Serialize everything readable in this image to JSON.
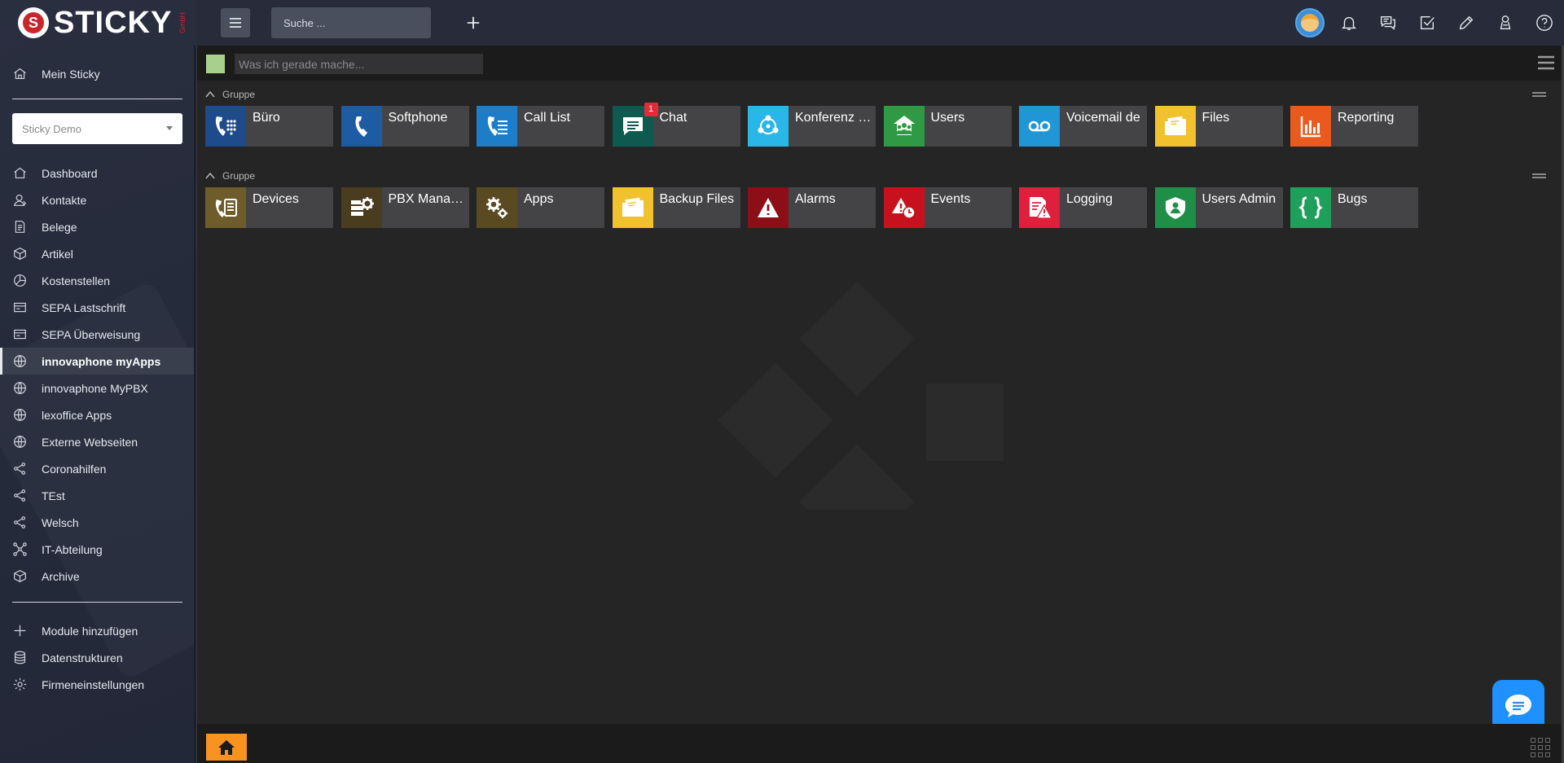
{
  "brand": {
    "name": "STICKY",
    "sub": "GmbH",
    "mark": "S"
  },
  "sidebar": {
    "top_item": {
      "label": "Mein Sticky",
      "icon": "home-chart-icon"
    },
    "tenant": {
      "selected": "Sticky Demo"
    },
    "items": [
      {
        "label": "Dashboard",
        "icon": "home-icon"
      },
      {
        "label": "Kontakte",
        "icon": "contacts-icon"
      },
      {
        "label": "Belege",
        "icon": "document-icon"
      },
      {
        "label": "Artikel",
        "icon": "box-icon"
      },
      {
        "label": "Kostenstellen",
        "icon": "pie-icon"
      },
      {
        "label": "SEPA Lastschrift",
        "icon": "card-icon"
      },
      {
        "label": "SEPA Überweisung",
        "icon": "card-icon"
      },
      {
        "label": "innovaphone myApps",
        "icon": "globe-icon",
        "active": true
      },
      {
        "label": "innovaphone MyPBX",
        "icon": "globe-icon"
      },
      {
        "label": "lexoffice Apps",
        "icon": "globe-icon"
      },
      {
        "label": "Externe Webseiten",
        "icon": "globe-icon"
      },
      {
        "label": "Coronahilfen",
        "icon": "share-icon"
      },
      {
        "label": "TEst",
        "icon": "share-icon"
      },
      {
        "label": "Welsch",
        "icon": "share-icon"
      },
      {
        "label": "IT-Abteilung",
        "icon": "network-icon"
      },
      {
        "label": "Archive",
        "icon": "box-icon"
      }
    ],
    "bottom_items": [
      {
        "label": "Module hinzufügen",
        "icon": "plus-icon"
      },
      {
        "label": "Datenstrukturen",
        "icon": "database-icon"
      },
      {
        "label": "Firmeneinstellungen",
        "icon": "gear-icon"
      }
    ]
  },
  "topbar": {
    "search_placeholder": "Suche ...",
    "icons": [
      "avatar",
      "bell-icon",
      "chat-bubbles-icon",
      "checkbox-icon",
      "pencil-icon",
      "user-icon",
      "help-icon"
    ]
  },
  "status": {
    "placeholder": "Was ich gerade mache..."
  },
  "groups": [
    {
      "title": "Gruppe",
      "tiles": [
        {
          "label": "Büro",
          "color": "#1e4b8c",
          "icon": "phone-keypad-icon"
        },
        {
          "label": "Softphone",
          "color": "#1d5ba3",
          "icon": "phone-icon"
        },
        {
          "label": "Call List",
          "color": "#1d7dc9",
          "icon": "phone-list-icon"
        },
        {
          "label": "Chat",
          "color": "#0f5a50",
          "icon": "chat-icon",
          "badge": "1"
        },
        {
          "label": "Konferenz - ...",
          "color": "#29b6e8",
          "icon": "conference-icon"
        },
        {
          "label": "Users",
          "color": "#2e9b44",
          "icon": "users-icon"
        },
        {
          "label": "Voicemail de",
          "color": "#2196d6",
          "icon": "voicemail-icon"
        },
        {
          "label": "Files",
          "color": "#f2c12e",
          "icon": "folder-icon"
        },
        {
          "label": "Reporting",
          "color": "#ea5a1e",
          "icon": "report-chart-icon"
        }
      ]
    },
    {
      "title": "Gruppe",
      "tiles": [
        {
          "label": "Devices",
          "color": "#6e5d2a",
          "icon": "device-phone-icon"
        },
        {
          "label": "PBX Manager",
          "color": "#4a3c1e",
          "icon": "server-gear-icon"
        },
        {
          "label": "Apps",
          "color": "#5a4a22",
          "icon": "gears-icon"
        },
        {
          "label": "Backup Files",
          "color": "#f2c12e",
          "icon": "folder-icon"
        },
        {
          "label": "Alarms",
          "color": "#8c0e16",
          "icon": "warning-icon"
        },
        {
          "label": "Events",
          "color": "#c7121e",
          "icon": "warning-clock-icon"
        },
        {
          "label": "Logging",
          "color": "#e01f3d",
          "icon": "log-warning-icon"
        },
        {
          "label": "Users Admin",
          "color": "#1f8f47",
          "icon": "user-shield-icon"
        },
        {
          "label": "Bugs",
          "color": "#1fa05a",
          "icon": "braces-icon"
        }
      ]
    }
  ]
}
